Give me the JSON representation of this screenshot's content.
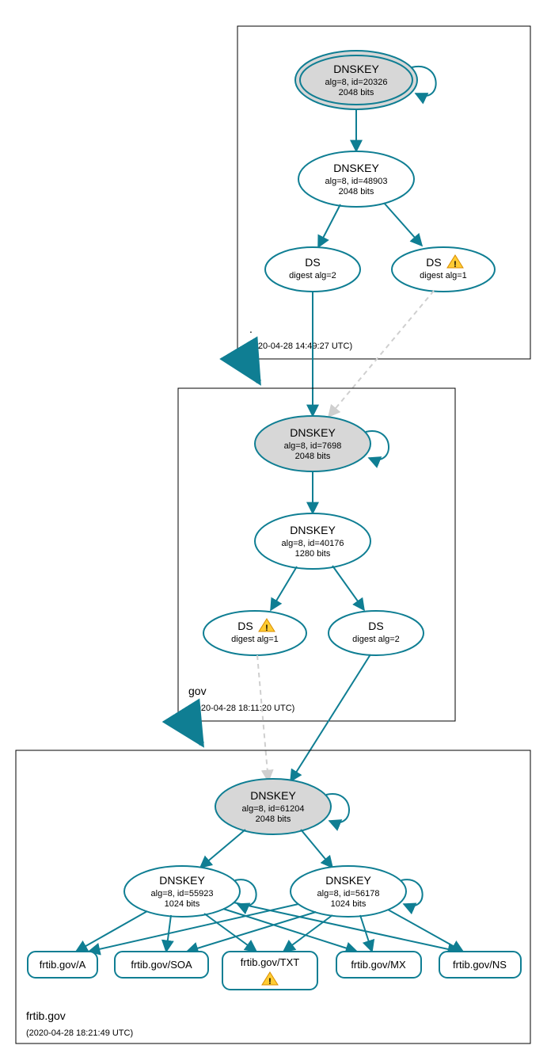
{
  "zones": {
    "root": {
      "label": ".",
      "timestamp": "(2020-04-28 14:49:27 UTC)"
    },
    "gov": {
      "label": "gov",
      "timestamp": "(2020-04-28 18:11:20 UTC)"
    },
    "frtib": {
      "label": "frtib.gov",
      "timestamp": "(2020-04-28 18:21:49 UTC)"
    }
  },
  "nodes": {
    "root_ksk": {
      "title": "DNSKEY",
      "l1": "alg=8, id=20326",
      "l2": "2048 bits"
    },
    "root_zsk": {
      "title": "DNSKEY",
      "l1": "alg=8, id=48903",
      "l2": "2048 bits"
    },
    "root_ds2": {
      "title": "DS",
      "l1": "digest alg=2"
    },
    "root_ds1": {
      "title": "DS",
      "l1": "digest alg=1"
    },
    "gov_ksk": {
      "title": "DNSKEY",
      "l1": "alg=8, id=7698",
      "l2": "2048 bits"
    },
    "gov_zsk": {
      "title": "DNSKEY",
      "l1": "alg=8, id=40176",
      "l2": "1280 bits"
    },
    "gov_ds1": {
      "title": "DS",
      "l1": "digest alg=1"
    },
    "gov_ds2": {
      "title": "DS",
      "l1": "digest alg=2"
    },
    "frtib_ksk": {
      "title": "DNSKEY",
      "l1": "alg=8, id=61204",
      "l2": "2048 bits"
    },
    "frtib_zsk1": {
      "title": "DNSKEY",
      "l1": "alg=8, id=55923",
      "l2": "1024 bits"
    },
    "frtib_zsk2": {
      "title": "DNSKEY",
      "l1": "alg=8, id=56178",
      "l2": "1024 bits"
    }
  },
  "rr": {
    "a": "frtib.gov/A",
    "soa": "frtib.gov/SOA",
    "txt": "frtib.gov/TXT",
    "mx": "frtib.gov/MX",
    "ns": "frtib.gov/NS"
  }
}
